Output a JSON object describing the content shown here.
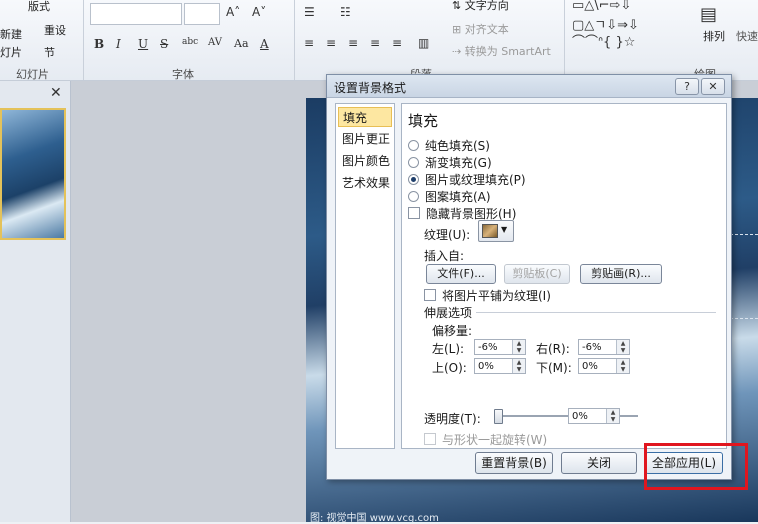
{
  "ribbon": {
    "layout_label": "版式",
    "new_label": "新建",
    "reset_label": "重设",
    "slide_btn_label": "灯片",
    "section_label": "节",
    "group_slides": "幻灯片",
    "group_font": "字体",
    "group_paragraph": "段落",
    "group_drawing": "绘图",
    "text_direction": "文字方向",
    "align_text": "对齐文本",
    "convert_smartart": "转换为 SmartArt",
    "arrange_label": "排列",
    "quick_styles": "快速",
    "font_buttons": [
      "B",
      "I",
      "U",
      "S",
      "abc",
      "AV",
      "Aa",
      "A"
    ]
  },
  "dialog": {
    "title": "设置背景格式",
    "help": "?",
    "close": "✕",
    "nav": [
      "填充",
      "图片更正",
      "图片颜色",
      "艺术效果"
    ],
    "section_title": "填充",
    "options": [
      {
        "label": "纯色填充(S)",
        "selected": false
      },
      {
        "label": "渐变填充(G)",
        "selected": false
      },
      {
        "label": "图片或纹理填充(P)",
        "selected": true
      },
      {
        "label": "图案填充(A)",
        "selected": false
      }
    ],
    "hide_bg_graphics": "隐藏背景图形(H)",
    "texture_label": "纹理(U):",
    "insert_from": "插入自:",
    "file_btn": "文件(F)...",
    "clipboard_btn": "剪贴板(C)",
    "clipart_btn": "剪贴画(R)...",
    "tile_label": "将图片平铺为纹理(I)",
    "stretch_options": "伸展选项",
    "offset_label": "偏移量:",
    "left_label": "左(L):",
    "left_val": "-6%",
    "right_label": "右(R):",
    "right_val": "-6%",
    "top_label": "上(O):",
    "top_val": "0%",
    "bottom_label": "下(M):",
    "bottom_val": "0%",
    "transparency_label": "透明度(T):",
    "transparency_val": "0%",
    "rotate_label": "与形状一起旋转(W)",
    "reset_btn": "重置背景(B)",
    "close_btn": "关闭",
    "apply_all_btn": "全部应用(L)"
  },
  "watermark": "图: 视觉中国 www.vcg.com",
  "colors": {
    "highlight": "#e0161f",
    "nav_selected": "#fde7a1"
  }
}
